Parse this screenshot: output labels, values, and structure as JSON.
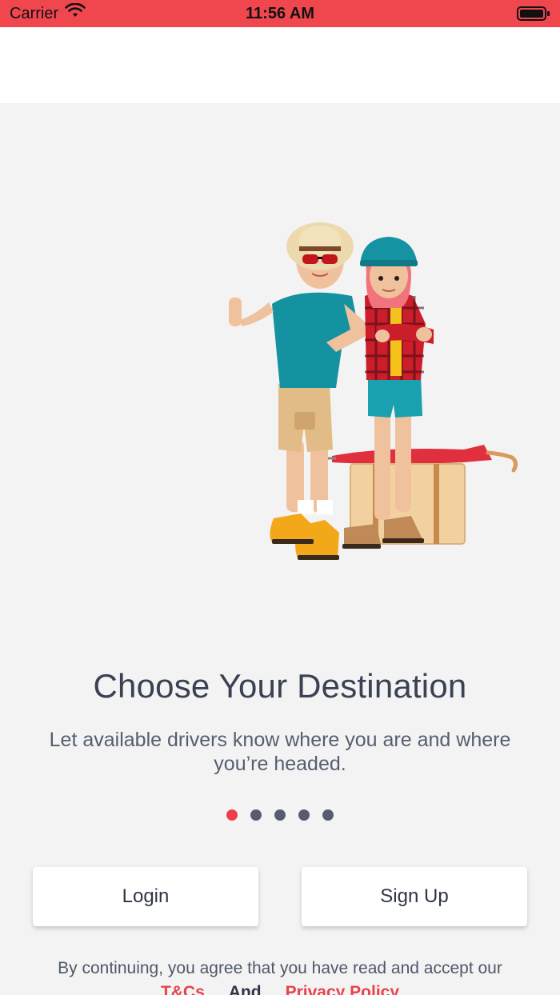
{
  "status_bar": {
    "carrier": "Carrier",
    "time": "11:56 AM"
  },
  "onboarding": {
    "title": "Choose Your Destination",
    "subtitle": "Let available drivers know where you are and where you’re headed.",
    "pager": {
      "total": 5,
      "active_index": 0
    }
  },
  "actions": {
    "login_label": "Login",
    "signup_label": "Sign Up"
  },
  "footer": {
    "agree_text": "By continuing, you agree that you have read and accept our",
    "terms_label": "T&Cs",
    "and_text": "And",
    "privacy_label": "Privacy Policy"
  },
  "colors": {
    "accent": "#f0474f",
    "dot_inactive": "#555c70",
    "text_dark": "#3a4152",
    "background": "#f3f3f4"
  }
}
